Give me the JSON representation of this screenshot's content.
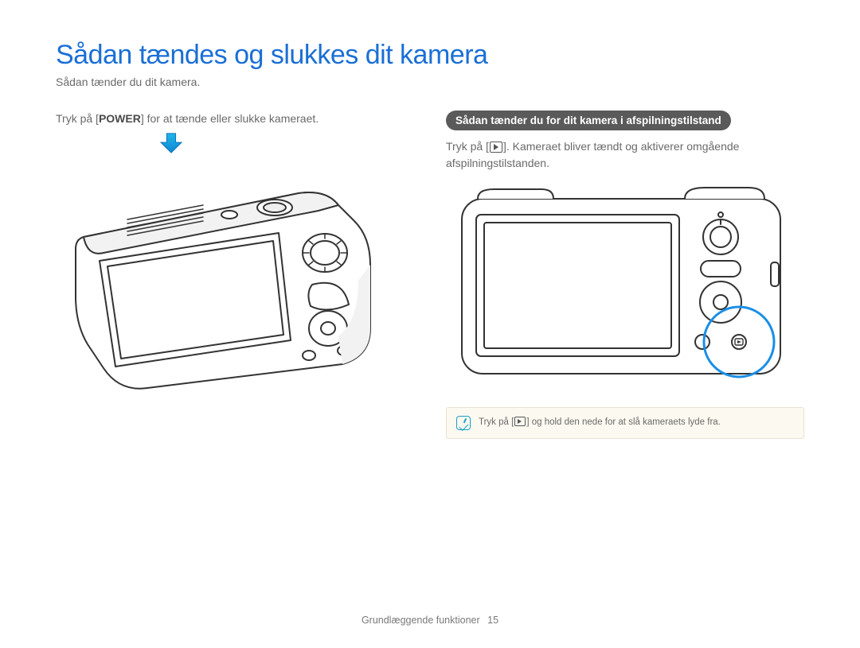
{
  "title": "Sådan tændes og slukkes dit kamera",
  "intro": "Sådan tænder du dit kamera.",
  "left": {
    "instr_pre": "Tryk på [",
    "instr_bold": "POWER",
    "instr_post": "] for at tænde eller slukke kameraet."
  },
  "right": {
    "pill": "Sådan tænder du for dit kamera i afspilningstilstand",
    "instr_pre": "Tryk på [",
    "instr_post": "]. Kameraet bliver tændt og aktiverer omgående afspilningstilstanden.",
    "note_pre": "Tryk på [",
    "note_post": "] og hold den nede for at slå kameraets lyde fra."
  },
  "footer": {
    "section": "Grundlæggende funktioner",
    "page": "15"
  }
}
